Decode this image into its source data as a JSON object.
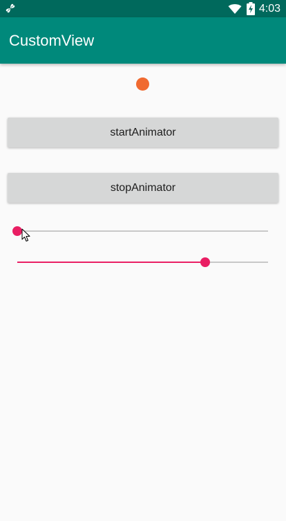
{
  "status_bar": {
    "time": "4:03",
    "icons": [
      "fan-icon",
      "wifi-icon",
      "battery-charging-icon"
    ],
    "background": "#00695c"
  },
  "app_bar": {
    "title": "CustomView",
    "background": "#00897b"
  },
  "animated_dot": {
    "color": "#f06a30"
  },
  "buttons": {
    "start_label": "startAnimator",
    "stop_label": "stopAnimator"
  },
  "sliders": [
    {
      "value": 0.0,
      "accent": "#e91e63"
    },
    {
      "value": 0.75,
      "accent": "#e91e63"
    }
  ]
}
